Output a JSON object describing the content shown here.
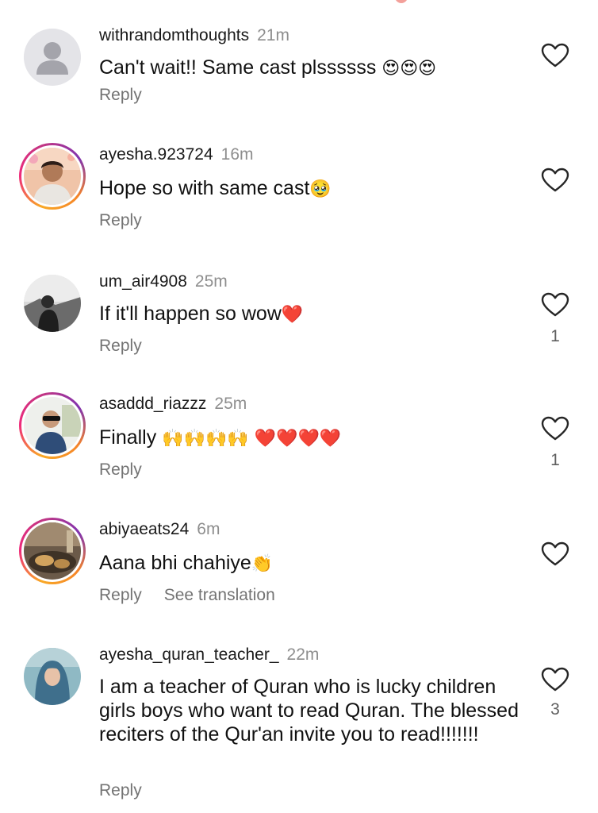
{
  "ui": {
    "reply_label": "Reply",
    "see_translation_label": "See translation"
  },
  "comments": [
    {
      "username": "withrandomthoughts",
      "time": "21m",
      "text": "Can't wait!! Same cast plssssss ",
      "emoji": "😍😍😍",
      "likes": "",
      "avatar": "default-avatar-icon"
    },
    {
      "username": "ayesha.923724",
      "time": "16m",
      "text": "Hope so with same cast",
      "emoji": "🥹",
      "likes": "",
      "avatar": "profile-photo"
    },
    {
      "username": "um_air4908",
      "time": "25m",
      "text": "If it'll happen so wow",
      "emoji": "❤️",
      "likes": "1",
      "avatar": "profile-photo"
    },
    {
      "username": "asaddd_riazzz",
      "time": "25m",
      "text": "Finally ",
      "emoji": "🙌🙌🙌🙌 ❤️❤️❤️❤️",
      "likes": "1",
      "avatar": "profile-photo"
    },
    {
      "username": "abiyaeats24",
      "time": "6m",
      "text": "Aana bhi chahiye",
      "emoji": "👏",
      "likes": "",
      "avatar": "profile-photo"
    },
    {
      "username": "ayesha_quran_teacher_",
      "time": "22m",
      "text": "I am a teacher of Quran who is lucky children girls boys who want to read Quran.  The blessed reciters of the Qur'an invite you to read!!!!!!!",
      "emoji": "",
      "likes": "3",
      "avatar": "profile-photo"
    }
  ],
  "colors": {
    "text": "#111111",
    "muted": "#737373",
    "story_ring_start": "#f9a825",
    "story_ring_end": "#c13584"
  }
}
